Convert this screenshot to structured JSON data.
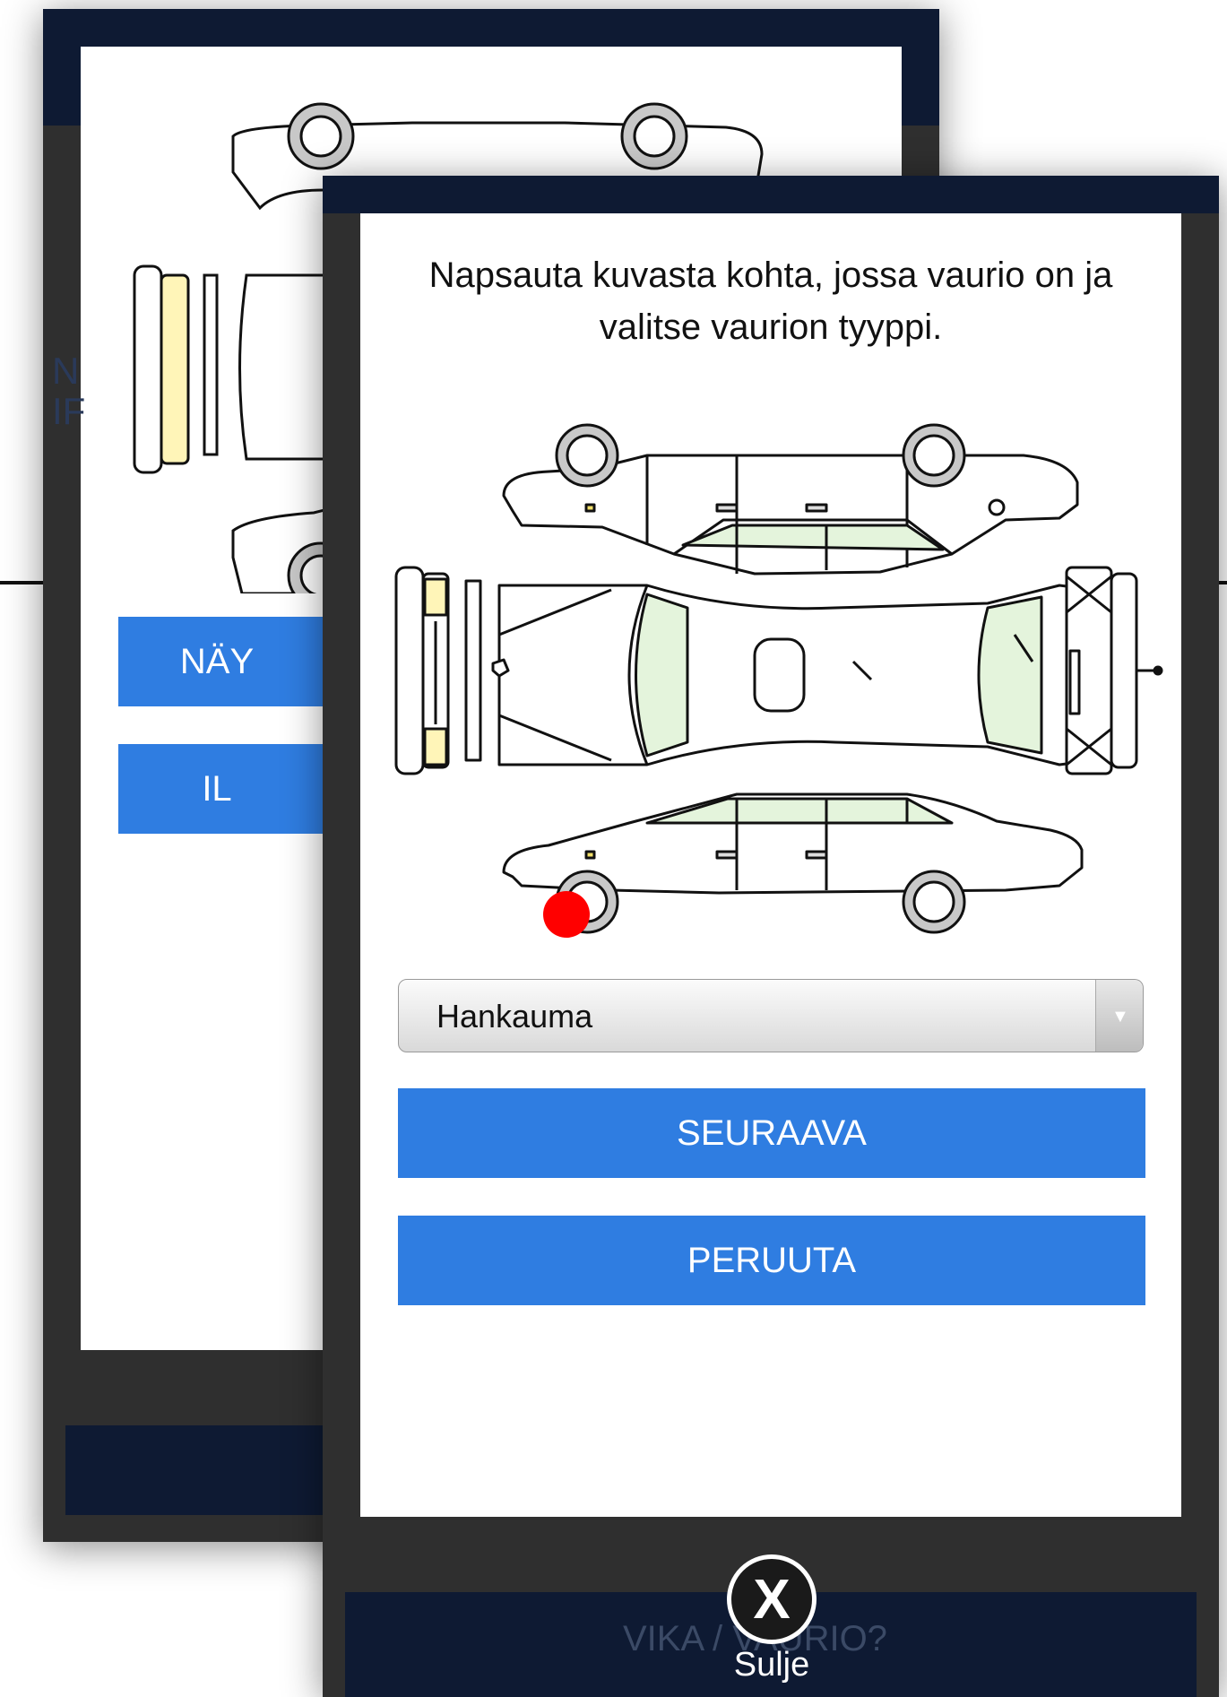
{
  "instruction": "Napsauta kuvasta kohta, jossa vaurio on ja valitse vaurion tyyppi.",
  "damage_type": {
    "selected": "Hankauma"
  },
  "buttons": {
    "next": "SEURAAVA",
    "cancel": "PERUUTA"
  },
  "close": {
    "label": "Sulje",
    "icon_glyph": "X"
  },
  "background_screen": {
    "button_1_fragment": "NÄY",
    "button_2_fragment": "IL",
    "side_text_1": "N",
    "side_text_2": "IF",
    "bottom_bar_text": "VIKA / VAURIO?"
  },
  "colors": {
    "accent_blue": "#2f7de1",
    "navy": "#0e1a33",
    "damage_marker": "#ff0000",
    "window_tint": "#e4f4dc",
    "bumper_yellow": "#fff5b8"
  },
  "icons": [
    "car-damage-diagram",
    "damage-marker",
    "dropdown-arrow-icon",
    "close-icon"
  ]
}
